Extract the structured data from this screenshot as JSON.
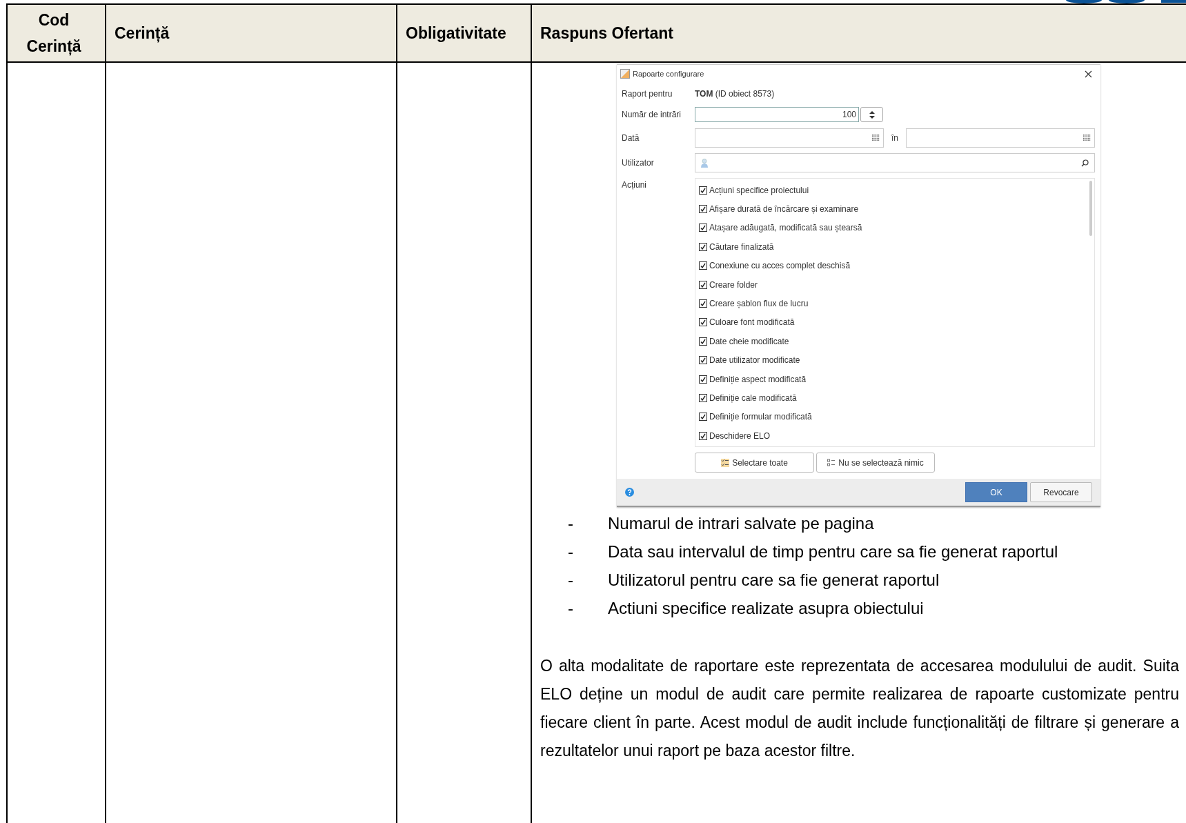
{
  "table": {
    "columns": [
      "Cod Cerință",
      "Cerință",
      "Obligativitate",
      "Raspuns Ofertant"
    ]
  },
  "dialog": {
    "title": "Rapoarte configurare",
    "report_for": {
      "label": "Raport pentru",
      "value": "**TOM** (ID obiect 8573)"
    },
    "entries": {
      "label": "Număr de intrări",
      "value": "100"
    },
    "date": {
      "label": "Dată",
      "separator": "în"
    },
    "user": {
      "label": "Utilizator"
    },
    "actions": {
      "label": "Acțiuni",
      "items": [
        {
          "label": "Acțiuni specifice proiectului",
          "checked": true
        },
        {
          "label": "Afișare durată de încărcare și examinare",
          "checked": true
        },
        {
          "label": "Atașare adăugată, modificată sau ștearsă",
          "checked": true
        },
        {
          "label": "Căutare finalizată",
          "checked": true
        },
        {
          "label": "Conexiune cu acces complet deschisă",
          "checked": true
        },
        {
          "label": "Creare folder",
          "checked": true
        },
        {
          "label": "Creare șablon flux de lucru",
          "checked": true
        },
        {
          "label": "Culoare font modificată",
          "checked": true
        },
        {
          "label": "Date cheie modificate",
          "checked": true
        },
        {
          "label": "Date utilizator modificate",
          "checked": true
        },
        {
          "label": "Definiție aspect modificată",
          "checked": true
        },
        {
          "label": "Definiție cale modificată",
          "checked": true
        },
        {
          "label": "Definiție formular modificată",
          "checked": true
        },
        {
          "label": "Deschidere ELO",
          "checked": true
        }
      ]
    },
    "select_buttons": [
      "Selectare toate",
      "Nu se selectează nimic"
    ],
    "footer_buttons": [
      "OK",
      "Revocare"
    ]
  },
  "bullets": [
    {
      "marker": "-",
      "text": "Numarul de intrari salvate pe pagina"
    },
    {
      "marker": "-",
      "text": "Data sau intervalul de timp pentru care sa fie generat raportul"
    },
    {
      "marker": "-",
      "text": "Utilizatorul pentru care sa fie generat raportul"
    },
    {
      "marker": "-",
      "text": "Actiuni specifice realizate asupra obiectului"
    }
  ],
  "paragraph": "O alta modalitate de raportare este reprezentata de accesarea modulului de audit. Suita ELO deține un modul de audit care permite realizarea de rapoarte customizate pentru fiecare client în parte. Acest modul de audit include funcționalități de filtrare și generare a rezultatelor unui raport pe baza acestor filtre."
}
